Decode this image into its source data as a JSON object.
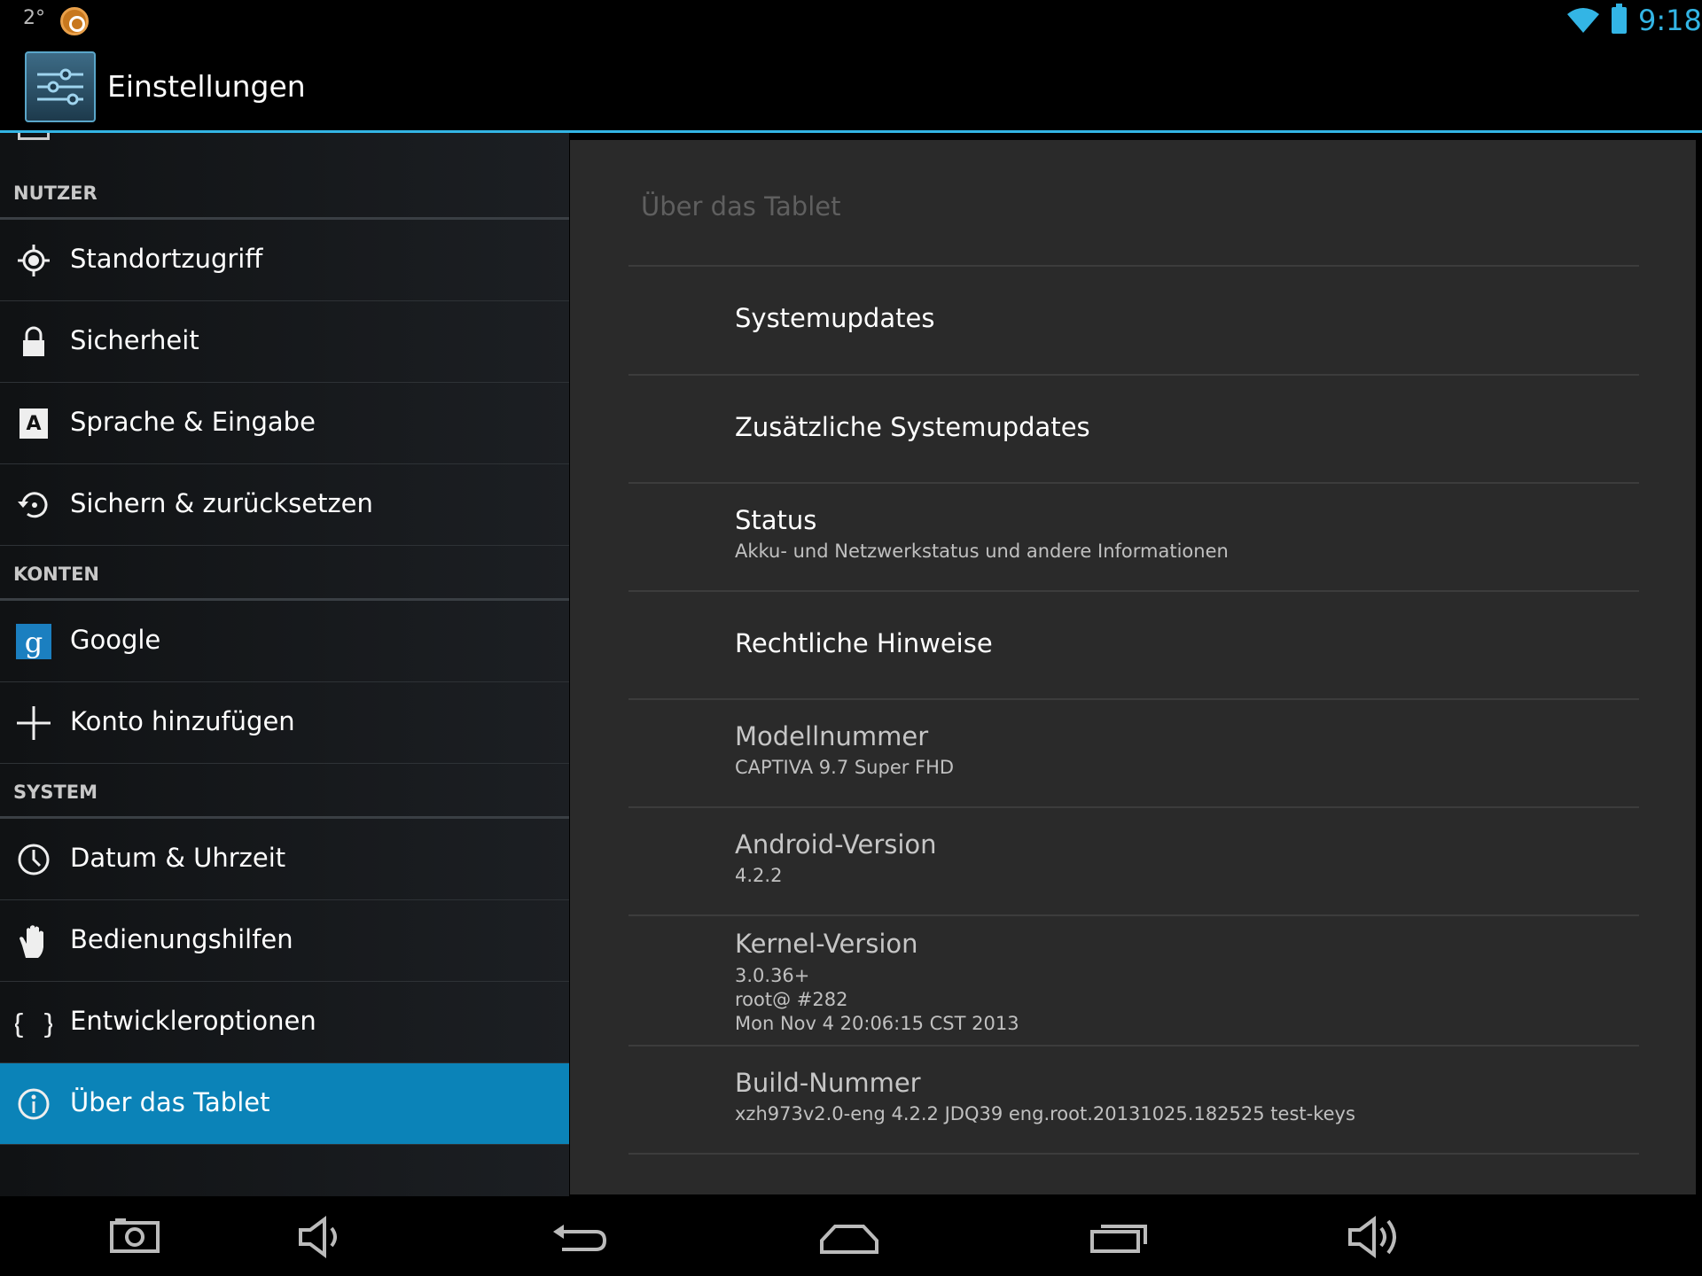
{
  "status_bar": {
    "temperature": "2°",
    "time": "9:18",
    "accent": "#33b5e5"
  },
  "action_bar": {
    "title": "Einstellungen",
    "icon": "settings-sliders-icon"
  },
  "sidebar": {
    "sections": [
      {
        "header": "NUTZER"
      },
      {
        "header": "KONTEN"
      },
      {
        "header": "SYSTEM"
      }
    ],
    "items": [
      {
        "label": "Standortzugriff",
        "icon": "location-icon"
      },
      {
        "label": "Sicherheit",
        "icon": "lock-icon"
      },
      {
        "label": "Sprache & Eingabe",
        "icon": "language-keyboard-icon"
      },
      {
        "label": "Sichern & zurücksetzen",
        "icon": "backup-restore-icon"
      },
      {
        "label": "Google",
        "icon": "google-icon"
      },
      {
        "label": "Konto hinzufügen",
        "icon": "plus-icon"
      },
      {
        "label": "Datum & Uhrzeit",
        "icon": "clock-icon"
      },
      {
        "label": "Bedienungshilfen",
        "icon": "hand-icon"
      },
      {
        "label": "Entwickleroptionen",
        "icon": "braces-icon"
      },
      {
        "label": "Über das Tablet",
        "icon": "info-icon",
        "selected": true
      }
    ]
  },
  "detail": {
    "title": "Über das Tablet",
    "prefs": [
      {
        "title": "Systemupdates",
        "summary": ""
      },
      {
        "title": "Zusätzliche Systemupdates",
        "summary": ""
      },
      {
        "title": "Status",
        "summary": "Akku- und Netzwerkstatus und andere Informationen"
      },
      {
        "title": "Rechtliche Hinweise",
        "summary": ""
      },
      {
        "title": "Modellnummer",
        "summary": "CAPTIVA 9.7 Super FHD"
      },
      {
        "title": "Android-Version",
        "summary": "4.2.2"
      },
      {
        "title": "Kernel-Version",
        "summary": "3.0.36+\nroot@ #282\nMon Nov 4 20:06:15 CST 2013"
      },
      {
        "title": "Build-Nummer",
        "summary": "xzh973v2.0-eng 4.2.2 JDQ39 eng.root.20131025.182525 test-keys"
      }
    ]
  },
  "nav_bar": {
    "buttons": [
      "screenshot-icon",
      "volume-down-icon",
      "back-icon",
      "home-icon",
      "recents-icon",
      "volume-up-icon"
    ]
  }
}
